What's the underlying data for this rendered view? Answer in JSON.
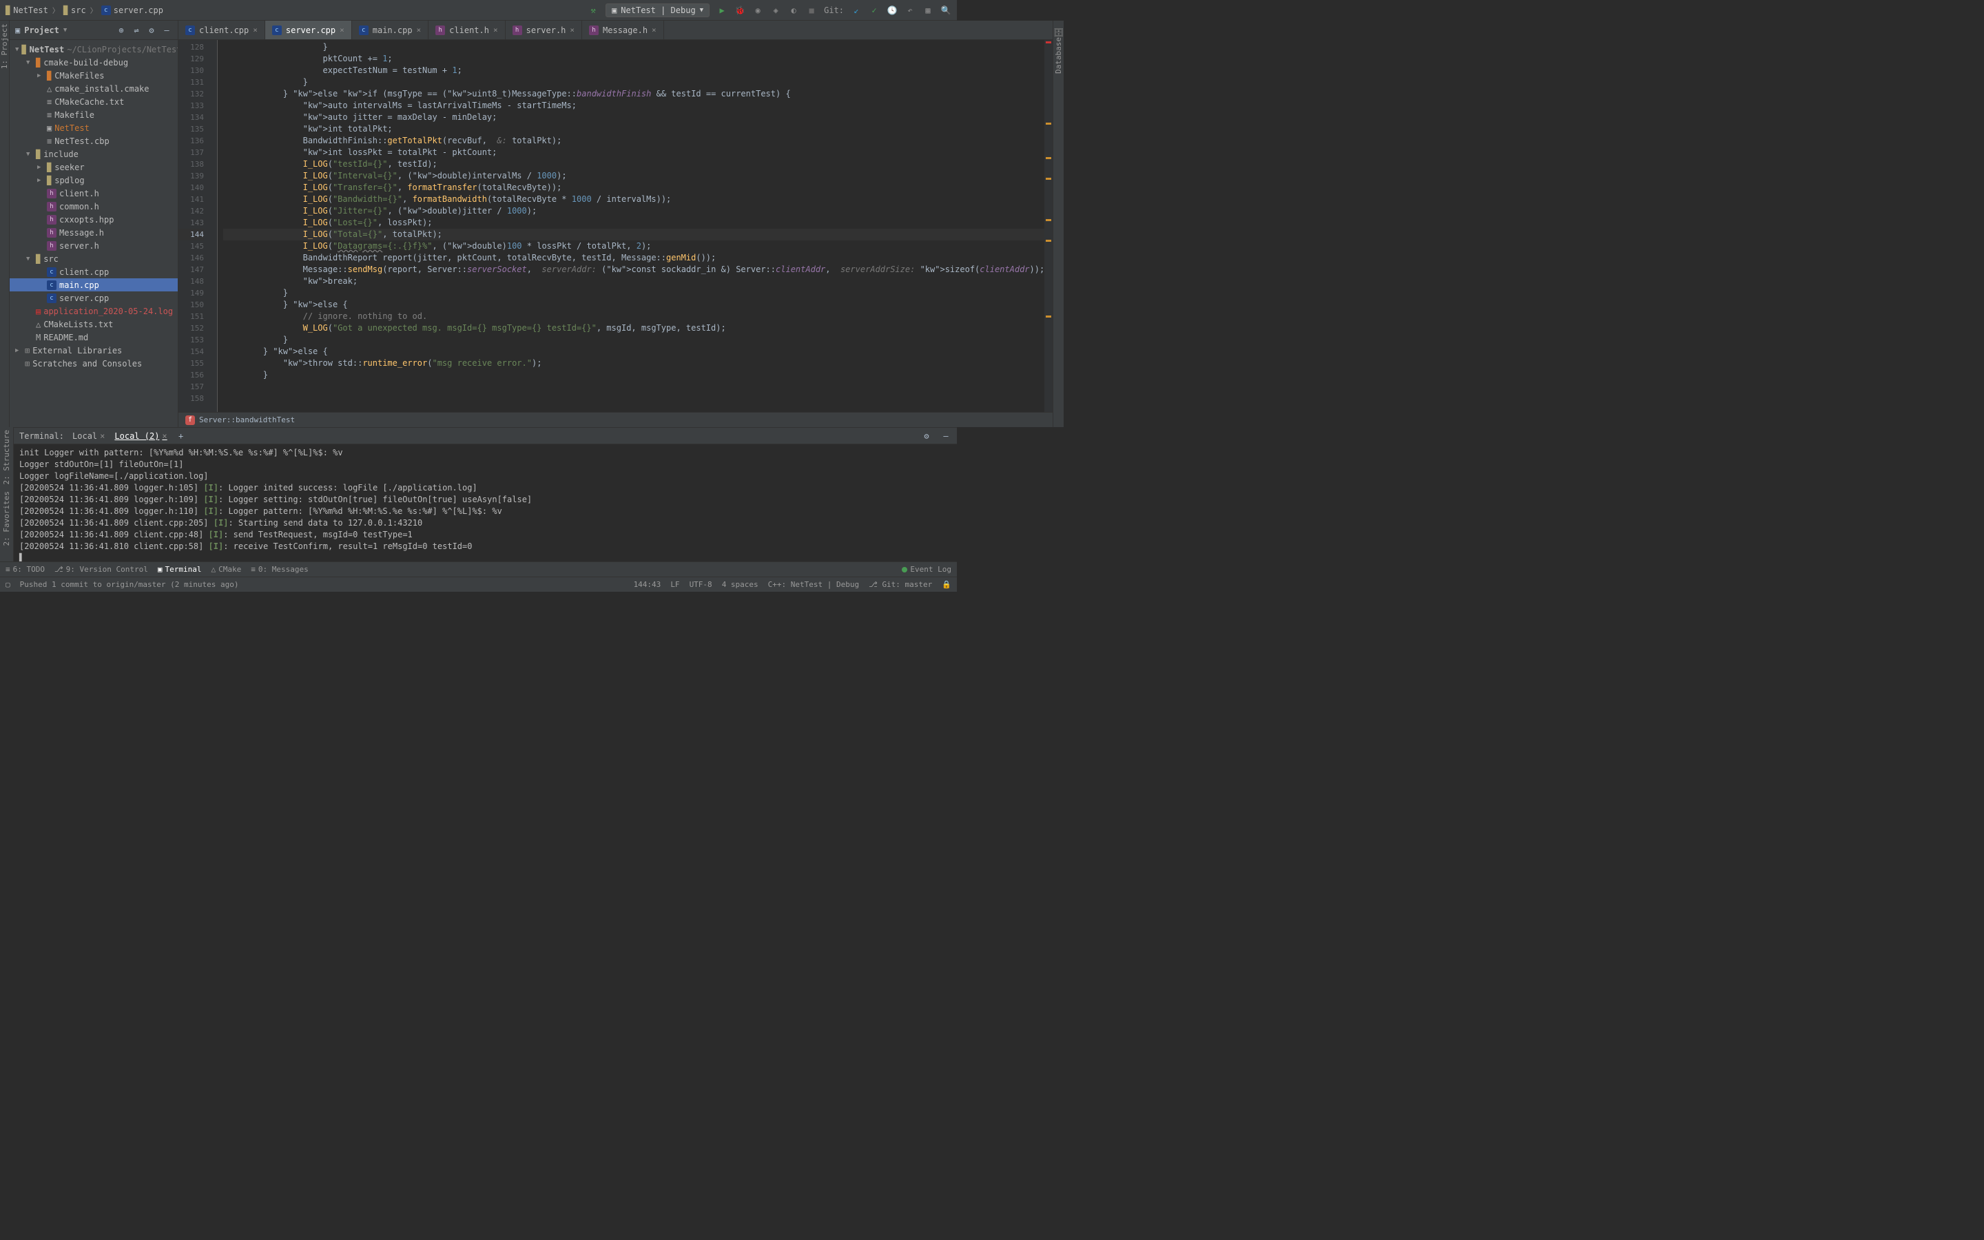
{
  "breadcrumb": {
    "project": "NetTest",
    "folder": "src",
    "file": "server.cpp"
  },
  "toolbar": {
    "config": "NetTest | Debug",
    "git_label": "Git:"
  },
  "project_panel": {
    "title": "Project",
    "root": {
      "name": "NetTest",
      "path": "~/CLionProjects/NetTest"
    },
    "items": [
      {
        "indent": 1,
        "arrow": "▼",
        "icon": "folder-orange",
        "label": "cmake-build-debug"
      },
      {
        "indent": 2,
        "arrow": "▶",
        "icon": "folder-orange",
        "label": "CMakeFiles"
      },
      {
        "indent": 2,
        "arrow": "",
        "icon": "cmake",
        "label": "cmake_install.cmake"
      },
      {
        "indent": 2,
        "arrow": "",
        "icon": "txt",
        "label": "CMakeCache.txt"
      },
      {
        "indent": 2,
        "arrow": "",
        "icon": "txt",
        "label": "Makefile"
      },
      {
        "indent": 2,
        "arrow": "",
        "icon": "bin",
        "label": "NetTest",
        "color": "#cc7832"
      },
      {
        "indent": 2,
        "arrow": "",
        "icon": "txt",
        "label": "NetTest.cbp"
      },
      {
        "indent": 1,
        "arrow": "▼",
        "icon": "folder",
        "label": "include"
      },
      {
        "indent": 2,
        "arrow": "▶",
        "icon": "folder",
        "label": "seeker"
      },
      {
        "indent": 2,
        "arrow": "▶",
        "icon": "folder",
        "label": "spdlog"
      },
      {
        "indent": 2,
        "arrow": "",
        "icon": "h",
        "label": "client.h"
      },
      {
        "indent": 2,
        "arrow": "",
        "icon": "h",
        "label": "common.h"
      },
      {
        "indent": 2,
        "arrow": "",
        "icon": "h",
        "label": "cxxopts.hpp"
      },
      {
        "indent": 2,
        "arrow": "",
        "icon": "h",
        "label": "Message.h"
      },
      {
        "indent": 2,
        "arrow": "",
        "icon": "h",
        "label": "server.h"
      },
      {
        "indent": 1,
        "arrow": "▼",
        "icon": "folder",
        "label": "src"
      },
      {
        "indent": 2,
        "arrow": "",
        "icon": "cpp",
        "label": "client.cpp"
      },
      {
        "indent": 2,
        "arrow": "",
        "icon": "cpp",
        "label": "main.cpp",
        "sel": true
      },
      {
        "indent": 2,
        "arrow": "",
        "icon": "cpp",
        "label": "server.cpp"
      },
      {
        "indent": 1,
        "arrow": "",
        "icon": "log",
        "label": "application_2020-05-24.log",
        "color": "#cc5555"
      },
      {
        "indent": 1,
        "arrow": "",
        "icon": "cmake",
        "label": "CMakeLists.txt"
      },
      {
        "indent": 1,
        "arrow": "",
        "icon": "md",
        "label": "README.md"
      }
    ],
    "extra": [
      {
        "arrow": "▶",
        "label": "External Libraries"
      },
      {
        "arrow": "",
        "label": "Scratches and Consoles"
      }
    ]
  },
  "tabs": [
    {
      "icon": "cpp",
      "label": "client.cpp"
    },
    {
      "icon": "cpp",
      "label": "server.cpp",
      "active": true
    },
    {
      "icon": "cpp",
      "label": "main.cpp"
    },
    {
      "icon": "h",
      "label": "client.h"
    },
    {
      "icon": "h",
      "label": "server.h"
    },
    {
      "icon": "h",
      "label": "Message.h"
    }
  ],
  "gutter_start": 128,
  "gutter_end": 158,
  "current_line": 144,
  "code_lines": [
    "                    }",
    "                    pktCount += 1;",
    "                    expectTestNum = testNum + 1;",
    "                }",
    "            } else if (msgType == (uint8_t)MessageType::bandwidthFinish && testId == currentTest) {",
    "                auto intervalMs = lastArrivalTimeMs - startTimeMs;",
    "                auto jitter = maxDelay - minDelay;",
    "                int totalPkt;",
    "                BandwidthFinish::getTotalPkt(recvBuf,  &: totalPkt);",
    "                int lossPkt = totalPkt - pktCount;",
    "                I_LOG(\"testId={}\", testId);",
    "                I_LOG(\"Interval={}\", (double)intervalMs / 1000);",
    "                I_LOG(\"Transfer={}\", formatTransfer(totalRecvByte));",
    "                I_LOG(\"Bandwidth={}\", formatBandwidth(totalRecvByte * 1000 / intervalMs));",
    "                I_LOG(\"Jitter={}\", (double)jitter / 1000);",
    "                I_LOG(\"Lost={}\", lossPkt);",
    "                I_LOG(\"Total={}\", totalPkt);",
    "                I_LOG(\"Datagrams={:.{}f}%\", (double)100 * lossPkt / totalPkt, 2);",
    "",
    "                BandwidthReport report(jitter, pktCount, totalRecvByte, testId, Message::genMid());",
    "                Message::sendMsg(report, Server::serverSocket,  serverAddr: (const sockaddr_in &) Server::clientAddr,  serverAddrSize: sizeof(clientAddr));",
    "",
    "                break;",
    "            }",
    "            } else {",
    "                // ignore. nothing to od.",
    "                W_LOG(\"Got a unexpected msg. msgId={} msgType={} testId={}\", msgId, msgType, testId);",
    "            }",
    "        } else {",
    "            throw std::runtime_error(\"msg receive error.\");",
    "        }"
  ],
  "breadcrumb_fn": "Server::bandwidthTest",
  "terminal": {
    "title": "Terminal:",
    "tabs": [
      {
        "label": "Local"
      },
      {
        "label": "Local (2)",
        "active": true
      }
    ],
    "lines": [
      {
        "text": "init Logger with pattern: [%Y%m%d %H:%M:%S.%e %s:%#] %^[%L]%$: %v"
      },
      {
        "text": "Logger stdOutOn=[1] fileOutOn=[1]"
      },
      {
        "text": "Logger logFileName=[./application.log]"
      },
      {
        "ts": "[20200524 11:36:41.809 logger.h:105]",
        "lvl": "[I]",
        "msg": ": Logger inited success: logFile [./application.log]"
      },
      {
        "ts": "[20200524 11:36:41.809 logger.h:109]",
        "lvl": "[I]",
        "msg": ": Logger setting: stdOutOn[true] fileOutOn[true] useAsyn[false]"
      },
      {
        "ts": "[20200524 11:36:41.809 logger.h:110]",
        "lvl": "[I]",
        "msg": ": Logger pattern: [%Y%m%d %H:%M:%S.%e %s:%#] %^[%L]%$: %v"
      },
      {
        "ts": "[20200524 11:36:41.809 client.cpp:205]",
        "lvl": "[I]",
        "msg": ": Starting send data to 127.0.0.1:43210"
      },
      {
        "ts": "[20200524 11:36:41.809 client.cpp:48]",
        "lvl": "[I]",
        "msg": ": send TestRequest, msgId=0 testType=1"
      },
      {
        "ts": "[20200524 11:36:41.810 client.cpp:58]",
        "lvl": "[I]",
        "msg": ": receive TestConfirm, result=1 reMsgId=0 testId=0"
      }
    ]
  },
  "bottom_tools": {
    "todo": "6: TODO",
    "vcs": "9: Version Control",
    "terminal": "Terminal",
    "cmake": "CMake",
    "messages": "0: Messages",
    "event_log": "Event Log"
  },
  "status": {
    "push_msg": "Pushed 1 commit to origin/master (2 minutes ago)",
    "pos": "144:43",
    "eol": "LF",
    "enc": "UTF-8",
    "indent": "4 spaces",
    "context": "C++: NetTest | Debug",
    "branch": "Git: master"
  },
  "rails": {
    "left": "1: Project",
    "left2_a": "2: Structure",
    "left2_b": "2: Favorites",
    "right": "Database"
  }
}
